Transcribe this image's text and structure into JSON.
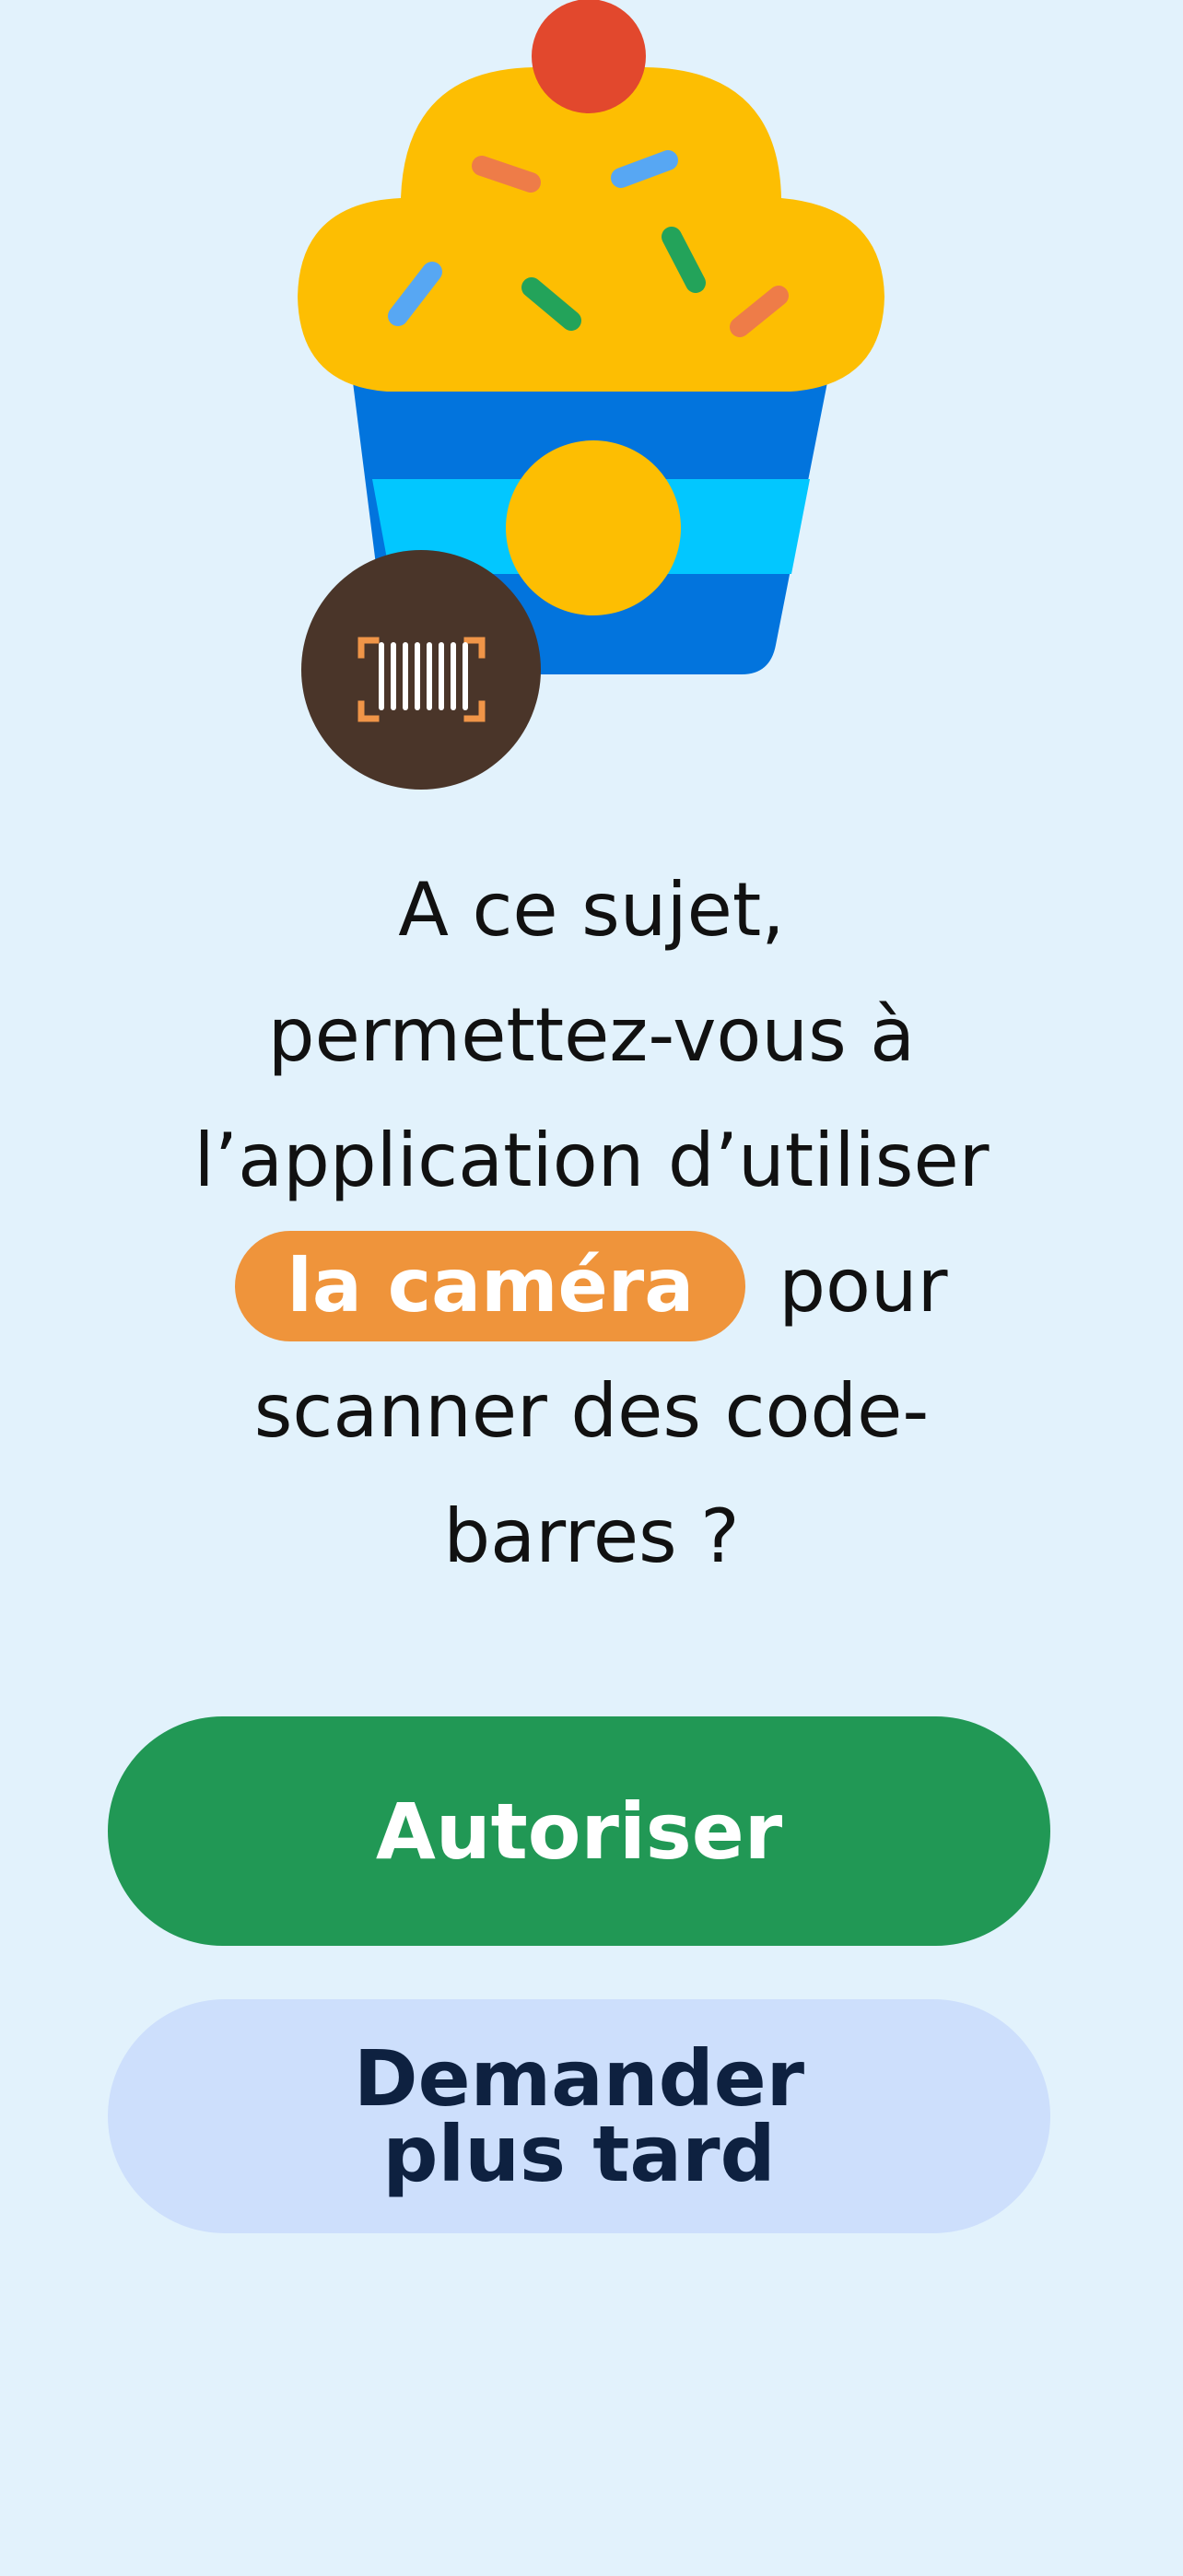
{
  "illustration": {
    "subject": "cupcake-with-barcode-scanner",
    "badge_icon": "barcode-scan-icon",
    "colors": {
      "frosting": "#fdbe02",
      "cherry": "#e2482d",
      "wrapper_dark": "#0274dd",
      "wrapper_light": "#02c7ff",
      "badge_bg": "#4a3529",
      "scan_corners": "#f09548"
    }
  },
  "prompt": {
    "line1": "A ce sujet,",
    "line2": "permettez-vous à",
    "line3": "l’application d’utiliser",
    "highlight": "la caméra",
    "after_highlight": "pour",
    "line5": "scanner des code-",
    "line6": "barres ?"
  },
  "actions": {
    "allow_label": "Autoriser",
    "later_label": "Demander plus tard"
  },
  "colors": {
    "background": "#e2f2fc",
    "allow_button": "#219855",
    "later_button": "#cddffc",
    "highlight_pill": "#ef943b"
  }
}
